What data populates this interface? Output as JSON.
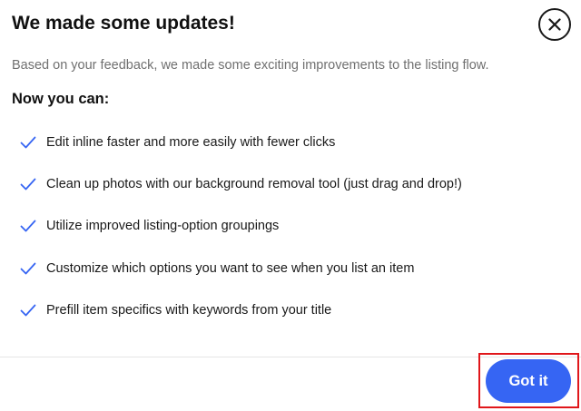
{
  "dialog": {
    "title": "We made some updates!",
    "subtitle": "Based on your feedback, we made some exciting improvements to the listing flow.",
    "heading": "Now you can:",
    "close_icon": "close-icon",
    "check_icon": "check-icon",
    "features": [
      "Edit inline faster and more easily with fewer clicks",
      "Clean up photos with our background removal tool (just drag and drop!)",
      "Utilize improved listing-option groupings",
      "Customize which options you want to see when you list an item",
      "Prefill item specifics with keywords from your title"
    ],
    "primary_button": "Got it"
  },
  "colors": {
    "primary": "#3665f3",
    "check": "#3665f3",
    "highlight": "#e0161a",
    "subtitle": "#707070"
  }
}
